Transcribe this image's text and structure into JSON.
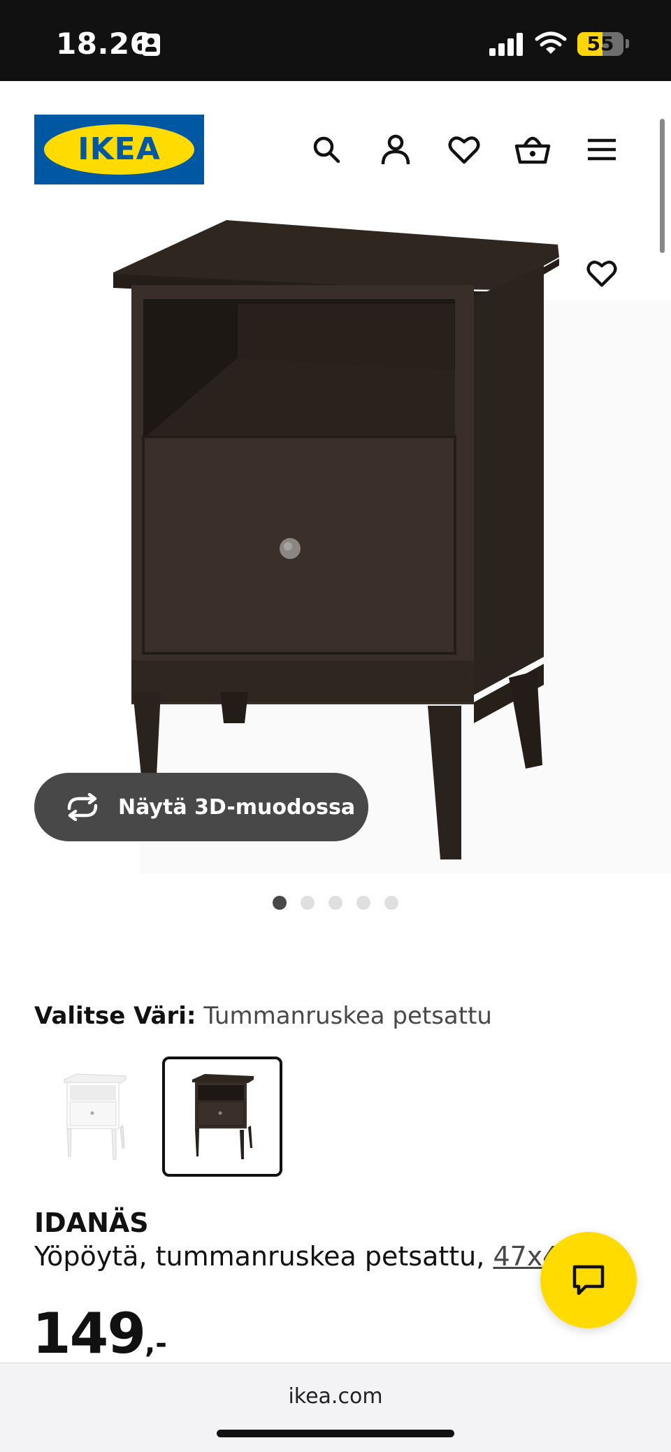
{
  "status_bar": {
    "time": "18.26",
    "battery": "55",
    "battery_level": 0.55
  },
  "header": {
    "logo_text": "IKEA",
    "icons": [
      "search-icon",
      "account-icon",
      "heart-icon",
      "basket-icon",
      "menu-icon"
    ]
  },
  "gallery": {
    "view_3d_label": "Näytä 3D-muodossa",
    "dots_count": 5,
    "active_dot": 1
  },
  "color_picker": {
    "label": "Valitse Väri:",
    "selected_value": "Tummanruskea petsattu",
    "options": [
      "white",
      "dark-brown"
    ],
    "selected_index": 1
  },
  "product": {
    "name": "IDANÄS",
    "description": "Yöpöytä, tummanruskea petsattu, ",
    "dimensions": "47x40",
    "price_integer": "149",
    "price_suffix": ",-"
  },
  "browser": {
    "url": "ikea.com"
  },
  "colors": {
    "ikea_blue": "#0058a3",
    "ikea_yellow": "#ffdb00",
    "furniture_brown": "#3b2f27"
  }
}
